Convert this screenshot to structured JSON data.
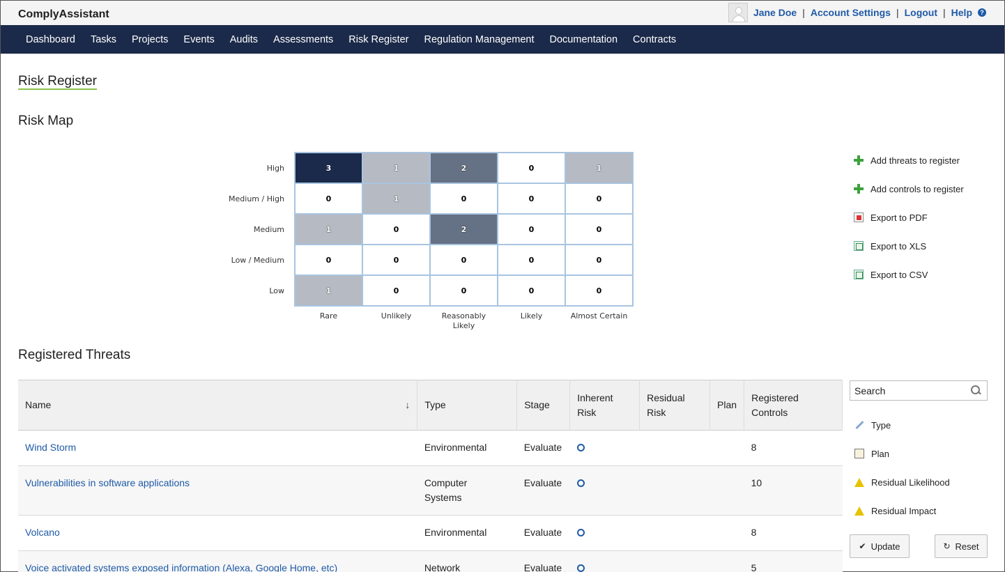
{
  "app": {
    "brand": "ComplyAssistant"
  },
  "user": {
    "name": "Jane Doe",
    "account_settings": "Account Settings",
    "logout": "Logout",
    "help": "Help",
    "separator": "|"
  },
  "nav": [
    "Dashboard",
    "Tasks",
    "Projects",
    "Events",
    "Audits",
    "Assessments",
    "Risk Register",
    "Regulation Management",
    "Documentation",
    "Contracts"
  ],
  "page_title": "Risk Register",
  "risk_map": {
    "title": "Risk Map",
    "impact_levels": [
      "High",
      "Medium / High",
      "Medium",
      "Low / Medium",
      "Low"
    ],
    "likelihood_levels": [
      "Rare",
      "Unlikely",
      "Reasonably Likely",
      "Likely",
      "Almost Certain"
    ],
    "counts": [
      [
        3,
        1,
        2,
        0,
        1
      ],
      [
        0,
        1,
        0,
        0,
        0
      ],
      [
        1,
        0,
        2,
        0,
        0
      ],
      [
        0,
        0,
        0,
        0,
        0
      ],
      [
        1,
        0,
        0,
        0,
        0
      ]
    ]
  },
  "actions": [
    {
      "label": "Add threats to register",
      "icon": "plus-icon"
    },
    {
      "label": "Add controls to register",
      "icon": "plus-icon"
    },
    {
      "label": "Export to PDF",
      "icon": "pdf-icon"
    },
    {
      "label": "Export to XLS",
      "icon": "xls-icon"
    },
    {
      "label": "Export to CSV",
      "icon": "csv-icon"
    }
  ],
  "threats": {
    "title": "Registered Threats",
    "columns": {
      "name": "Name",
      "type": "Type",
      "stage": "Stage",
      "inherent_1": "Inherent",
      "inherent_2": "Risk",
      "residual_1": "Residual",
      "residual_2": "Risk",
      "plan": "Plan",
      "controls_1": "Registered",
      "controls_2": "Controls"
    },
    "rows": [
      {
        "name": "Wind Storm",
        "type_1": "Environmental",
        "type_2": "",
        "stage": "Evaluate",
        "controls": "8"
      },
      {
        "name": "Vulnerabilities in software applications",
        "type_1": "Computer",
        "type_2": "Systems",
        "stage": "Evaluate",
        "controls": "10"
      },
      {
        "name": "Volcano",
        "type_1": "Environmental",
        "type_2": "",
        "stage": "Evaluate",
        "controls": "8"
      },
      {
        "name": "Voice activated systems exposed information (Alexa, Google Home, etc)",
        "type_1": "Network",
        "type_2": "",
        "stage": "Evaluate",
        "controls": "5"
      }
    ]
  },
  "sidebar": {
    "search_value": "Search",
    "filters": [
      {
        "label": "Type",
        "icon": "pencil-icon"
      },
      {
        "label": "Plan",
        "icon": "book-icon"
      },
      {
        "label": "Residual Likelihood",
        "icon": "warning-icon"
      },
      {
        "label": "Residual Impact",
        "icon": "warning-icon"
      }
    ],
    "update_label": "Update",
    "reset_label": "Reset"
  }
}
